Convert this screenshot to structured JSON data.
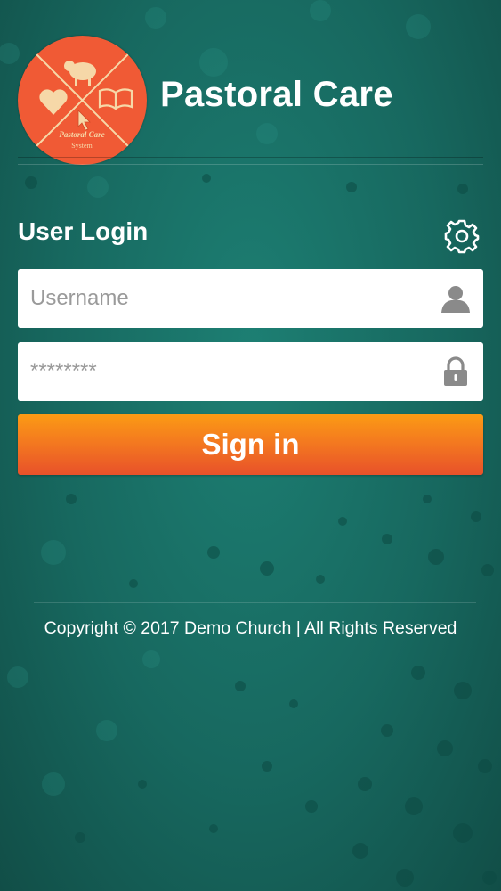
{
  "app": {
    "title": "Pastoral Care",
    "logo_text_line1": "Pastoral Care",
    "logo_text_line2": "System"
  },
  "login": {
    "heading": "User Login",
    "username_placeholder": "Username",
    "password_placeholder": "********",
    "signin_label": "Sign in"
  },
  "footer": {
    "copyright": "Copyright © 2017 Demo Church | All Rights Reserved"
  },
  "colors": {
    "background": "#17685f",
    "logo_circle": "#f05a35",
    "signin_top": "#fb9b14",
    "signin_bottom": "#e8512a",
    "icon_gray": "#8a8a8a"
  },
  "icons": {
    "settings": "gear-icon",
    "username": "user-icon",
    "password": "lock-icon"
  }
}
